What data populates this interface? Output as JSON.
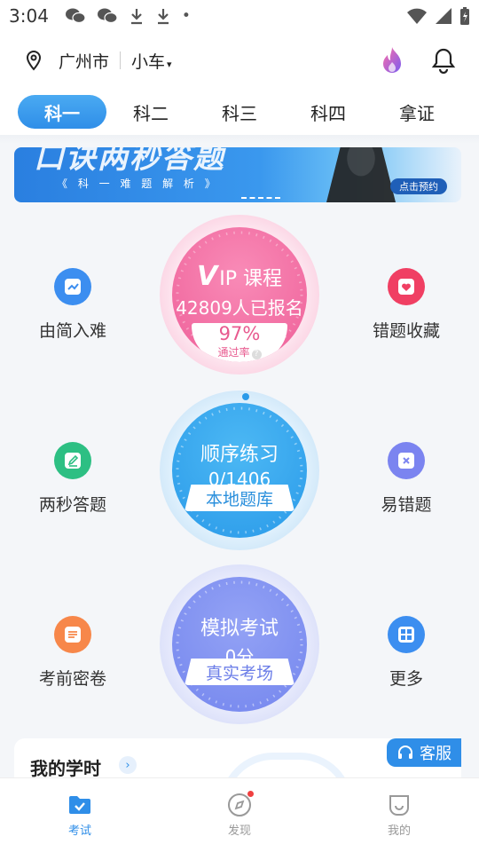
{
  "status_bar": {
    "time": "3:04",
    "icons": [
      "wechat-icon",
      "wechat-icon",
      "download-icon",
      "download-icon",
      "dot-icon",
      "wifi-icon",
      "signal-icon",
      "battery-icon"
    ]
  },
  "header": {
    "city": "广州市",
    "vehicle": "小车",
    "caret": "▾"
  },
  "tabs": [
    {
      "label": "科一",
      "active": true
    },
    {
      "label": "科二",
      "active": false
    },
    {
      "label": "科三",
      "active": false
    },
    {
      "label": "科四",
      "active": false
    },
    {
      "label": "拿证",
      "active": false
    }
  ],
  "banner": {
    "title": "口诀两秒答题",
    "subtitle": "《 科 一 难 题 解 析 》",
    "button": "点击预约"
  },
  "side_items": {
    "easy_to_hard": "由简入难",
    "wrong_collect": "错题收藏",
    "two_second": "两秒答题",
    "error_prone": "易错题",
    "pre_exam": "考前密卷",
    "more": "更多"
  },
  "vip": {
    "title": "IP 课程",
    "enrolled": "42809人已报名",
    "pass_rate": "97%",
    "pass_label": "通过率"
  },
  "sequential": {
    "title": "顺序练习",
    "progress": "0/1406",
    "ribbon": "本地题库",
    "progress_fraction": 0
  },
  "mock": {
    "title": "模拟考试",
    "score": "0分",
    "ribbon": "真实考场"
  },
  "study": {
    "title": "我的学时",
    "arrow": "›",
    "service": "客服"
  },
  "bottom_nav": [
    {
      "label": "考试",
      "active": true
    },
    {
      "label": "发现",
      "active": false
    },
    {
      "label": "我的",
      "active": false
    }
  ],
  "colors": {
    "accent": "#2f8ee8",
    "vip_pink": "#f06b9f",
    "sequence_blue": "#2da5ef",
    "mock_purple": "#7a8ef0"
  }
}
